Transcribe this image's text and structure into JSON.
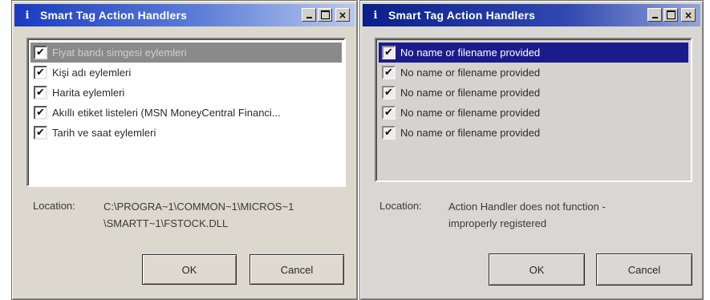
{
  "dialog_left": {
    "title": "Smart Tag Action Handlers",
    "title_icon": "i",
    "window_buttons": {
      "minimize": "_",
      "maximize": "□",
      "close": "×"
    },
    "items": [
      {
        "label": "Fiyat bandı simgesi eylemleri",
        "checked": true,
        "selected": true
      },
      {
        "label": "Kişi adı eylemleri",
        "checked": true,
        "selected": false
      },
      {
        "label": "Harita eylemleri",
        "checked": true,
        "selected": false
      },
      {
        "label": "Akıllı etiket listeleri (MSN MoneyCentral Financi...",
        "checked": true,
        "selected": false
      },
      {
        "label": "Tarih ve saat eylemleri",
        "checked": true,
        "selected": false
      }
    ],
    "location_label": "Location:",
    "location_line1": "C:\\PROGRA~1\\COMMON~1\\MICROS~1",
    "location_line2": "\\SMARTT~1\\FSTOCK.DLL",
    "ok_label": "OK",
    "cancel_label": "Cancel"
  },
  "dialog_right": {
    "title": "Smart Tag Action Handlers",
    "title_icon": "i",
    "window_buttons": {
      "minimize": "_",
      "maximize": "□",
      "close": "×"
    },
    "items": [
      {
        "label": "No name or filename provided",
        "checked": true,
        "selected": true
      },
      {
        "label": "No name or filename provided",
        "checked": true,
        "selected": false
      },
      {
        "label": "No name or filename provided",
        "checked": true,
        "selected": false
      },
      {
        "label": "No name or filename provided",
        "checked": true,
        "selected": false
      },
      {
        "label": "No name or filename provided",
        "checked": true,
        "selected": false
      }
    ],
    "location_label": "Location:",
    "location_line1": "Action Handler does not function -",
    "location_line2": "improperly registered",
    "ok_label": "OK",
    "cancel_label": "Cancel"
  },
  "colors": {
    "titlebar_left": "#1a3bbf",
    "titlebar_right": "#0a1f8a",
    "selection_left": "#8a8a8a",
    "selection_right": "#1c1b8c"
  },
  "icons": {
    "checkbox_checked": "checkmark-icon",
    "title": "info-icon"
  }
}
